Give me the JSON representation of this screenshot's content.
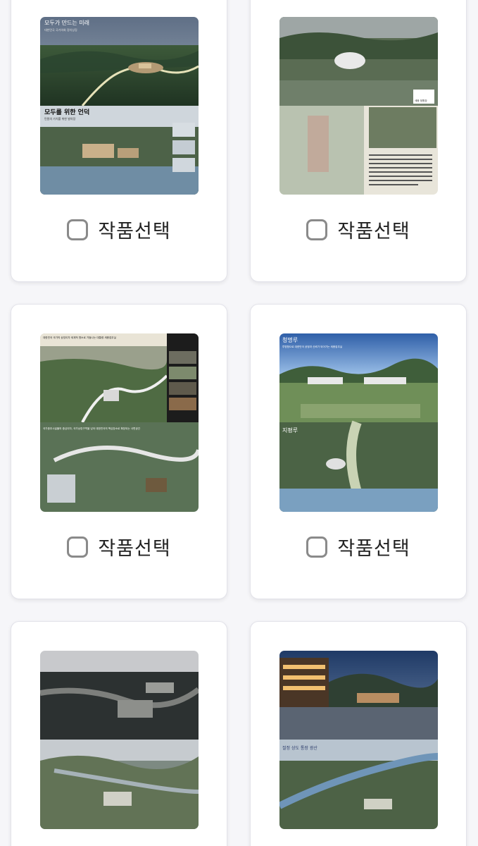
{
  "cards": [
    {
      "image": {
        "top_title": "모두가 만드는 미래",
        "top_subtitle": "대한민국 국가의회 정치상징",
        "bottom_title": "모두를 위한 언덕",
        "bottom_subtitle": "민원의 가치를 위한 발의장"
      },
      "select_label": "작품선택"
    },
    {
      "image": {
        "logo_text": "세종 정원장"
      },
      "select_label": "작품선택"
    },
    {
      "image": {
        "top_title": "대한민국 국가의 상징이자 세계적 명소로 거듭나는 대통령 세종집무실",
        "bottom_title": "국가중추시설물의 중심이자, 국가상징구역을 넘어 대한민국의 핵심장소로 확장되는 사면공간"
      },
      "select_label": "작품선택"
    },
    {
      "image": {
        "top_title": "청명루",
        "top_subtitle": "투명함으로 대한민국 공정과 신뢰가 되어가는 세종집무실",
        "bottom_title": "지평루"
      },
      "select_label": "작품선택"
    },
    {
      "image": {}
    },
    {
      "image": {
        "side_text": "절정 상도 통장 광산"
      }
    }
  ],
  "colors": {
    "checkbox_border": "#8a8a8a",
    "card_border": "#e3e3ea",
    "background": "#f6f6f9"
  },
  "icons": {
    "checkbox": "checkbox-unchecked-icon"
  }
}
